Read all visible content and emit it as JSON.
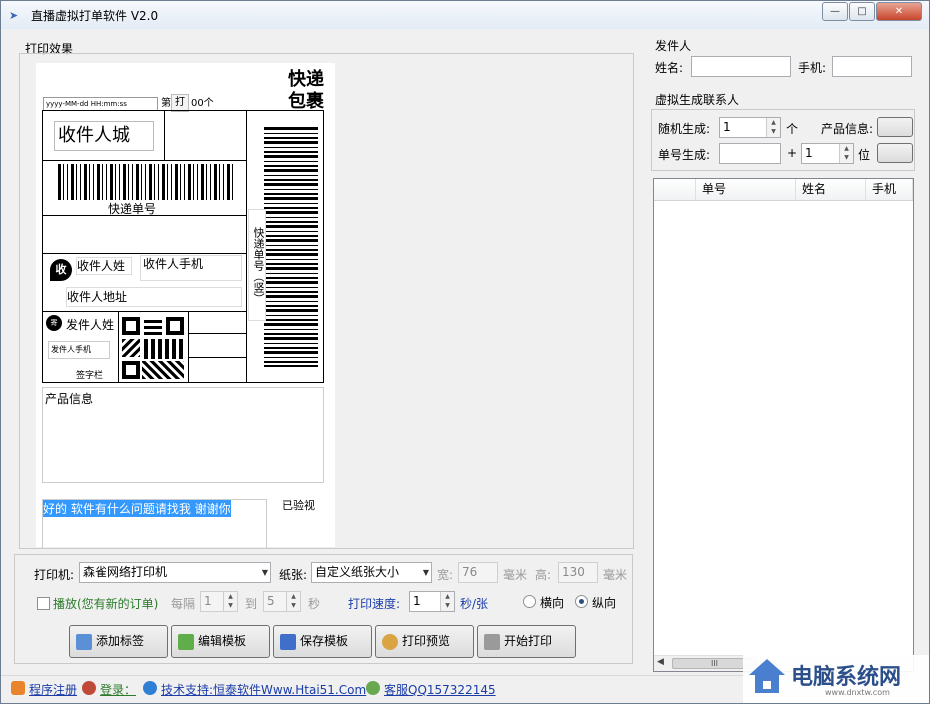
{
  "window": {
    "title": "直播虚拟打单软件 V2.0",
    "controls": [
      "—",
      "□",
      "✕"
    ]
  },
  "print_effect": {
    "group_label": "打印效果",
    "label": {
      "date_field": "yyyy-MM-dd HH:mm:ss",
      "seq_prefix": "第",
      "print_tag": "打",
      "seq_suffix": "00个",
      "courier_line1": "快递",
      "courier_line2": "包裹",
      "receiver_city": "收件人城",
      "tracking_no": "快递单号",
      "tracking_no_vertical": "快递单号（竖）",
      "receiver_badge": "收",
      "receiver_name": "收件人姓",
      "receiver_phone": "收件人手机",
      "receiver_address": "收件人地址",
      "sender_badge": "寄",
      "sender_name": "发件人姓",
      "sender_phone": "发件人手机",
      "signature": "签字栏",
      "product_info": "产品信息",
      "note_text": "好的 软件有什么问题请找我 谢谢你",
      "inspected": "已验视"
    }
  },
  "sender": {
    "group_label": "发件人",
    "name_label": "姓名:",
    "name_value": "",
    "phone_label": "手机:",
    "phone_value": ""
  },
  "virtual_contacts": {
    "group_label": "虚拟生成联系人",
    "random_label": "随机生成:",
    "random_value": "1",
    "random_unit": "个",
    "product_label": "产品信息:",
    "order_label": "单号生成:",
    "order_value": "",
    "plus": "+",
    "digits_value": "1",
    "digits_unit": "位",
    "columns": [
      "单号",
      "姓名",
      "手机"
    ],
    "scroll_marker": "III"
  },
  "print_settings": {
    "printer_label": "打印机:",
    "printer_value": "森雀网络打印机",
    "paper_label": "纸张:",
    "paper_value": "自定义纸张大小",
    "width_label": "宽:",
    "width_value": "76",
    "width_unit": "毫米",
    "height_label": "高:",
    "height_value": "130",
    "height_unit": "毫米",
    "play_label": "播放(您有新的订单)",
    "interval_label": "每隔",
    "interval_from": "1",
    "to_label": "到",
    "interval_to": "5",
    "sec_label": "秒",
    "speed_label": "打印速度:",
    "speed_value": "1",
    "speed_unit": "秒/张",
    "landscape": "横向",
    "portrait": "纵向"
  },
  "buttons": {
    "add_label": "添加标签",
    "edit_template": "编辑模板",
    "save_template": "保存模板",
    "print_preview": "打印预览",
    "start_print": "开始打印"
  },
  "statusbar": {
    "register": "程序注册",
    "login": "登录：",
    "support": "技术支持:恒泰软件Www.Htai51.Com",
    "service": "客服QQ157322145"
  },
  "watermark": {
    "brand": "电脑系统网",
    "url": "www.dnxtw.com"
  },
  "colors": {
    "window_bg": "#f0f0f0",
    "selection": "#3399ff",
    "link": "#1a3ca8",
    "accent_green": "#2a7a2a"
  }
}
